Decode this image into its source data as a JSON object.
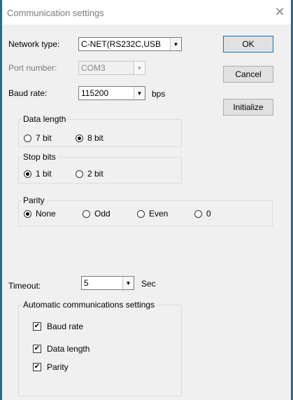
{
  "window": {
    "title": "Communication settings"
  },
  "network": {
    "label": "Network type:",
    "value": "C-NET(RS232C,USB"
  },
  "port": {
    "label": "Port number:",
    "value": "COM3"
  },
  "baud": {
    "label": "Baud rate:",
    "value": "115200",
    "unit": "bps"
  },
  "buttons": {
    "ok": "OK",
    "cancel": "Cancel",
    "initialize": "Initialize"
  },
  "data_length": {
    "legend": "Data length",
    "options": [
      {
        "label": "7 bit",
        "selected": false
      },
      {
        "label": "8 bit",
        "selected": true
      }
    ]
  },
  "stop_bits": {
    "legend": "Stop bits",
    "options": [
      {
        "label": "1 bit",
        "selected": true
      },
      {
        "label": "2 bit",
        "selected": false
      }
    ]
  },
  "parity": {
    "legend": "Parity",
    "options": [
      {
        "label": "None",
        "selected": true
      },
      {
        "label": "Odd",
        "selected": false
      },
      {
        "label": "Even",
        "selected": false
      },
      {
        "label": "0",
        "selected": false
      }
    ]
  },
  "timeout": {
    "label": "Timeout:",
    "value": "5",
    "unit": "Sec"
  },
  "auto": {
    "legend": "Automatic communications settings",
    "items": [
      {
        "label": "Baud rate",
        "checked": true
      },
      {
        "label": "Data length",
        "checked": true
      },
      {
        "label": "Parity",
        "checked": true
      }
    ]
  }
}
